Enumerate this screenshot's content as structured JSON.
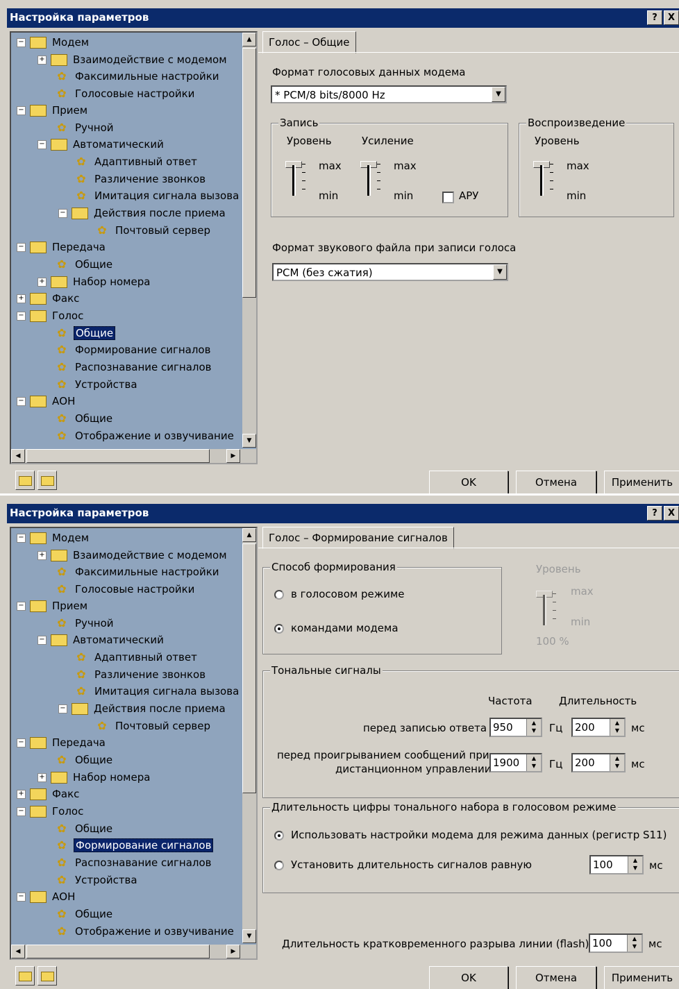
{
  "dialog_title": "Настройка параметров",
  "help_btn": "?",
  "close_btn": "X",
  "tree_items": [
    "Модем",
    "Взаимодействие с модемом",
    "Факсимильные настройки",
    "Голосовые настройки",
    "Прием",
    "Ручной",
    "Автоматический",
    "Адаптивный ответ",
    "Различение звонков",
    "Имитация сигнала вызова",
    "Действия после приема",
    "Почтовый сервер",
    "Передача",
    "Общие",
    "Набор номера",
    "Факс",
    "Голос",
    "Общие",
    "Формирование сигналов",
    "Распознавание сигналов",
    "Устройства",
    "АОН",
    "Общие",
    "Отображение и озвучивание"
  ],
  "buttons": {
    "ok": "OK",
    "cancel": "Отмена",
    "apply": "Применить"
  },
  "d1": {
    "tab": "Голос – Общие",
    "voice_format_label": "Формат голосовых данных модема",
    "voice_format_value": "* PCM/8 bits/8000 Hz",
    "record_group": "Запись",
    "level_label": "Уровень",
    "gain_label": "Усиление",
    "max": "max",
    "min": "min",
    "agc_label": "АРУ",
    "playback_group": "Воспроизведение",
    "playback_level": "Уровень",
    "file_format_label": "Формат звукового файла при записи голоса",
    "file_format_value": "PCM (без сжатия)"
  },
  "d2": {
    "tab": "Голос – Формирование сигналов",
    "method_group": "Способ формирования",
    "radio_voice": "в голосовом режиме",
    "radio_modem": "командами модема",
    "level_label": "Уровень",
    "max": "max",
    "min": "min",
    "level_pct": "100 %",
    "tones_group": "Тональные сигналы",
    "freq_header": "Частота",
    "dur_header": "Длительность",
    "row1_label": "перед записью ответа",
    "row1_freq": "950",
    "row1_dur": "200",
    "row2_label_1": "перед проигрыванием сообщений при",
    "row2_label_2": "дистанционном управлении",
    "row2_freq": "1900",
    "row2_dur": "200",
    "hz": "Гц",
    "ms": "мс",
    "dtmf_group": "Длительность цифры тонального набора в голосовом режиме",
    "dtmf_radio1": "Использовать настройки модема для режима данных (регистр S11)",
    "dtmf_radio2": "Установить длительность сигналов равную",
    "dtmf_value": "100",
    "flash_label": "Длительность кратковременного разрыва линии (flash)",
    "flash_value": "100"
  }
}
